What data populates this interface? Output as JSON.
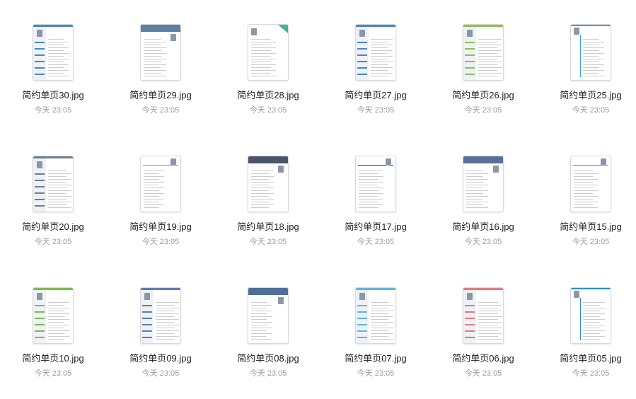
{
  "files": [
    {
      "name": "简约单页30.jpg",
      "date": "今天 23:05",
      "accent": "#4a86c5",
      "layout": "left-sidebar"
    },
    {
      "name": "简约单页29.jpg",
      "date": "今天 23:05",
      "accent": "#5c7fa3",
      "layout": "top-header"
    },
    {
      "name": "简约单页28.jpg",
      "date": "今天 23:05",
      "accent": "#3fb5a0",
      "layout": "corner-tag"
    },
    {
      "name": "简约单页27.jpg",
      "date": "今天 23:05",
      "accent": "#4a86c5",
      "layout": "left-sidebar"
    },
    {
      "name": "简约单页26.jpg",
      "date": "今天 23:05",
      "accent": "#8cc152",
      "layout": "left-sidebar"
    },
    {
      "name": "简约单页25.jpg",
      "date": "今天 23:05",
      "accent": "#3aa0d8",
      "layout": "timeline"
    },
    {
      "name": "简约单页20.jpg",
      "date": "今天 23:05",
      "accent": "#6f7d8c",
      "layout": "left-sidebar"
    },
    {
      "name": "简约单页19.jpg",
      "date": "今天 23:05",
      "accent": "#4a9fd8",
      "layout": "plain"
    },
    {
      "name": "简约单页18.jpg",
      "date": "今天 23:05",
      "accent": "#4a5568",
      "layout": "top-header"
    },
    {
      "name": "简约单页17.jpg",
      "date": "今天 23:05",
      "accent": "#2d3a4a",
      "layout": "plain"
    },
    {
      "name": "简约单页16.jpg",
      "date": "今天 23:05",
      "accent": "#5a6f99",
      "layout": "top-header"
    },
    {
      "name": "简约单页15.jpg",
      "date": "今天 23:05",
      "accent": "#3a86c8",
      "layout": "plain"
    },
    {
      "name": "简约单页10.jpg",
      "date": "今天 23:05",
      "accent": "#7cbd4a",
      "layout": "left-sidebar"
    },
    {
      "name": "简约单页09.jpg",
      "date": "今天 23:05",
      "accent": "#5b7fb0",
      "layout": "left-sidebar"
    },
    {
      "name": "简约单页08.jpg",
      "date": "今天 23:05",
      "accent": "#4f6f9a",
      "layout": "top-header"
    },
    {
      "name": "简约单页07.jpg",
      "date": "今天 23:05",
      "accent": "#5db8d8",
      "layout": "left-sidebar"
    },
    {
      "name": "简约单页06.jpg",
      "date": "今天 23:05",
      "accent": "#e77a7a",
      "layout": "left-sidebar"
    },
    {
      "name": "简约单页05.jpg",
      "date": "今天 23:05",
      "accent": "#2f8bc4",
      "layout": "timeline"
    }
  ]
}
